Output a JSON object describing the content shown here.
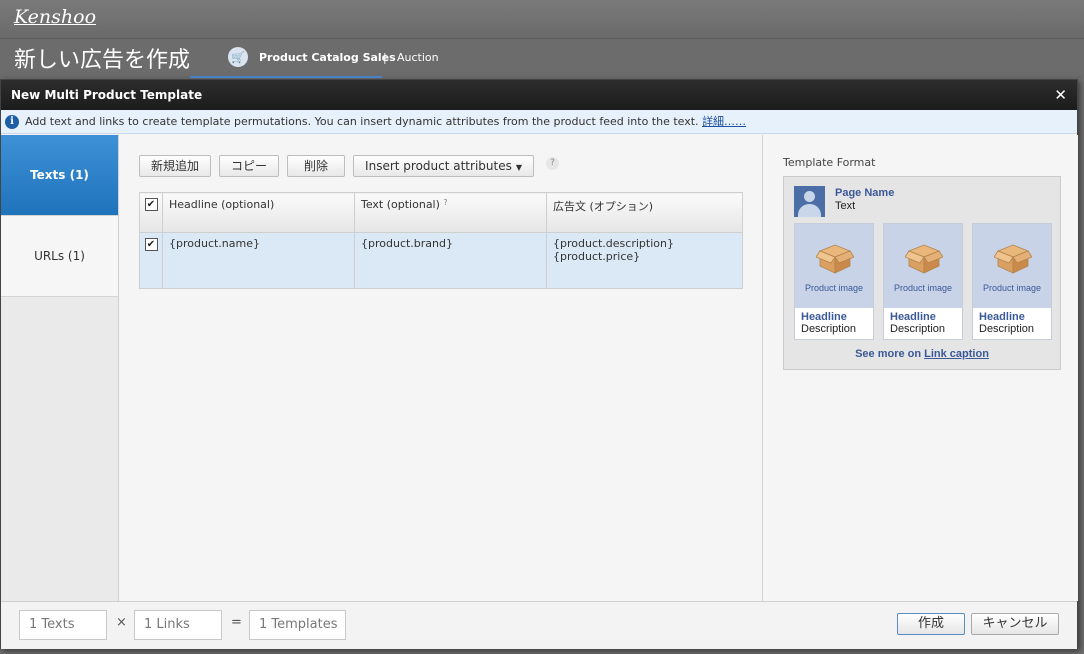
{
  "app": {
    "logo": "Kenshoo",
    "page_title": "新しい広告を作成",
    "breadcrumb": [
      "Product Catalog Sales",
      "|",
      "Auction"
    ]
  },
  "dialog": {
    "title": "New Multi Product Template",
    "close_glyph": "✕",
    "info_icon": "i",
    "info_text": "Add text and links to create template permutations. You can insert dynamic attributes from the product feed into the text. ",
    "info_link": "詳細……"
  },
  "tabs": [
    {
      "label": "Texts (1)",
      "active": true
    },
    {
      "label": "URLs (1)",
      "active": false
    }
  ],
  "toolbar": {
    "add_label": "新規追加",
    "copy_label": "コピー",
    "delete_label": "削除",
    "insert_label": "Insert product attributes",
    "help": "?"
  },
  "grid": {
    "columns": [
      "Headline (optional)",
      "Text (optional)",
      "広告文 (オプション)"
    ],
    "text_help": "?",
    "rows": [
      {
        "checked": true,
        "headline": "{product.name}",
        "text": "{product.brand}",
        "ad_text_line1": "{product.description}",
        "ad_text_line2": "{product.price}"
      }
    ],
    "header_checked": true
  },
  "template_format": {
    "title": "Template Format",
    "page_name": "Page Name",
    "page_text": "Text",
    "cards": [
      {
        "image_label": "Product image",
        "headline": "Headline",
        "description": "Description"
      },
      {
        "image_label": "Product image",
        "headline": "Headline",
        "description": "Description"
      },
      {
        "image_label": "Product image",
        "headline": "Headline",
        "description": "Description"
      }
    ],
    "see_more_prefix": "See more on ",
    "see_more_link": "Link caption"
  },
  "footer": {
    "texts_count": "1 Texts",
    "times": "×",
    "links_count": "1 Links",
    "equals": "=",
    "templates_count": "1 Templates",
    "create_label": "作成",
    "cancel_label": "キャンセル"
  },
  "colors": {
    "active_tab": "#2a80c8",
    "selected_row": "#dbe8f5",
    "fb_blue": "#3b5998"
  }
}
